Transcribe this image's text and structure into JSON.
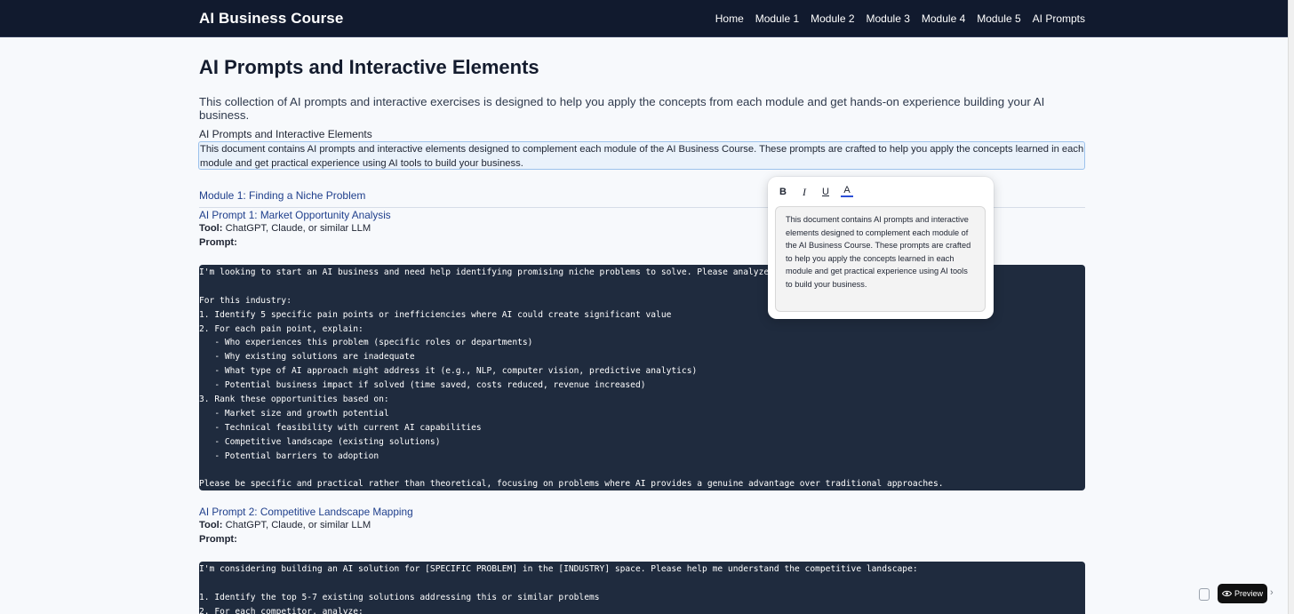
{
  "nav": {
    "brand": "AI Business Course",
    "links": [
      "Home",
      "Module 1",
      "Module 2",
      "Module 3",
      "Module 4",
      "Module 5",
      "AI Prompts"
    ]
  },
  "page": {
    "title": "AI Prompts and Interactive Elements",
    "intro": "This collection of AI prompts and interactive exercises is designed to help you apply the concepts from each module and get hands-on experience building your AI business."
  },
  "document": {
    "heading": "AI Prompts and Interactive Elements",
    "paragraph": "This document contains AI prompts and interactive elements designed to complement each module of the AI Business Course. These prompts are crafted to help you apply the concepts learned in each module and get practical experience using AI tools to build your business."
  },
  "module1": {
    "heading": "Module 1: Finding a Niche Problem"
  },
  "prompt1": {
    "title": "AI Prompt 1: Market Opportunity Analysis",
    "tool_label": "Tool:",
    "tool_value": "ChatGPT, Claude, or similar LLM",
    "prompt_label": "Prompt:",
    "lines": [
      "I'm looking to start an AI business and need help identifying promising niche problems to solve. Please analyze the [INDUSTRY OF INTEREST].",
      "",
      "For this industry:",
      "1. Identify 5 specific pain points or inefficiencies where AI could create significant value",
      "2. For each pain point, explain:",
      "   - Who experiences this problem (specific roles or departments)",
      "   - Why existing solutions are inadequate",
      "   - What type of AI approach might address it (e.g., NLP, computer vision, predictive analytics)",
      "   - Potential business impact if solved (time saved, costs reduced, revenue increased)",
      "3. Rank these opportunities based on:",
      "   - Market size and growth potential",
      "   - Technical feasibility with current AI capabilities",
      "   - Competitive landscape (existing solutions)",
      "   - Potential barriers to adoption",
      "",
      "Please be specific and practical rather than theoretical, focusing on problems where AI provides a genuine advantage over traditional approaches."
    ]
  },
  "prompt2": {
    "title": "AI Prompt 2: Competitive Landscape Mapping",
    "tool_label": "Tool:",
    "tool_value": "ChatGPT, Claude, or similar LLM",
    "prompt_label": "Prompt:",
    "lines": [
      "I'm considering building an AI solution for [SPECIFIC PROBLEM] in the [INDUSTRY] space. Please help me understand the competitive landscape:",
      "",
      "1. Identify the top 5-7 existing solutions addressing this or similar problems",
      "2. For each competitor, analyze:"
    ]
  },
  "editor_popup": {
    "toolbar": {
      "bold": "B",
      "italic": "I",
      "underline": "U",
      "color": "A"
    },
    "text": "This document contains AI prompts and interactive elements designed to complement each module of the AI Business Course. These prompts are crafted to help you apply the concepts learned in each module and get practical experience using AI tools to build your business."
  },
  "preview": {
    "label": "Preview",
    "icons": [
      "copy-icon",
      "eye-icon",
      "chevron-right-icon"
    ]
  },
  "colors": {
    "navbar": "#111a2e",
    "code_bg": "#1f2b3e",
    "link": "#1f3f8c",
    "highlight_border": "#9cc2ec"
  }
}
